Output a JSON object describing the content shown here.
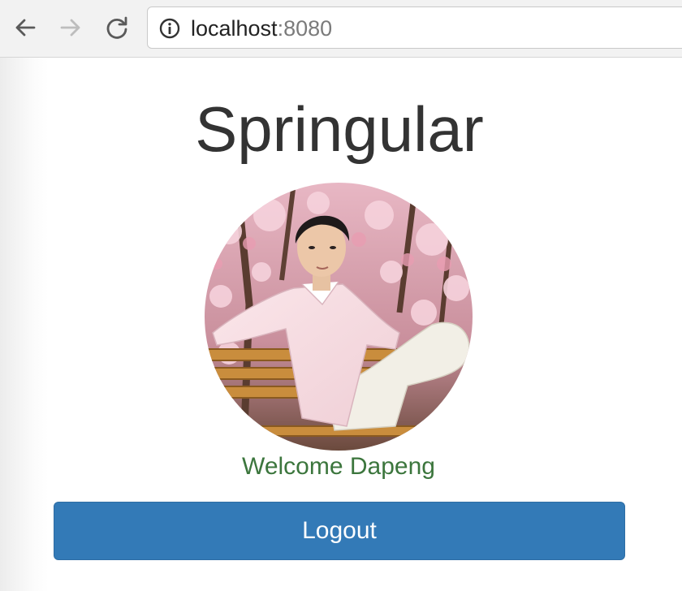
{
  "browser": {
    "back_icon": "arrow-left-icon",
    "forward_icon": "arrow-right-icon",
    "reload_icon": "reload-icon",
    "info_icon": "info-circle-icon",
    "url_host": "localhost",
    "url_port": ":8080"
  },
  "app": {
    "title": "Springular",
    "welcome_text": "Welcome Dapeng",
    "logout_label": "Logout",
    "colors": {
      "primary": "#337ab7",
      "success_text": "#3c763d",
      "title_text": "#333333"
    }
  }
}
